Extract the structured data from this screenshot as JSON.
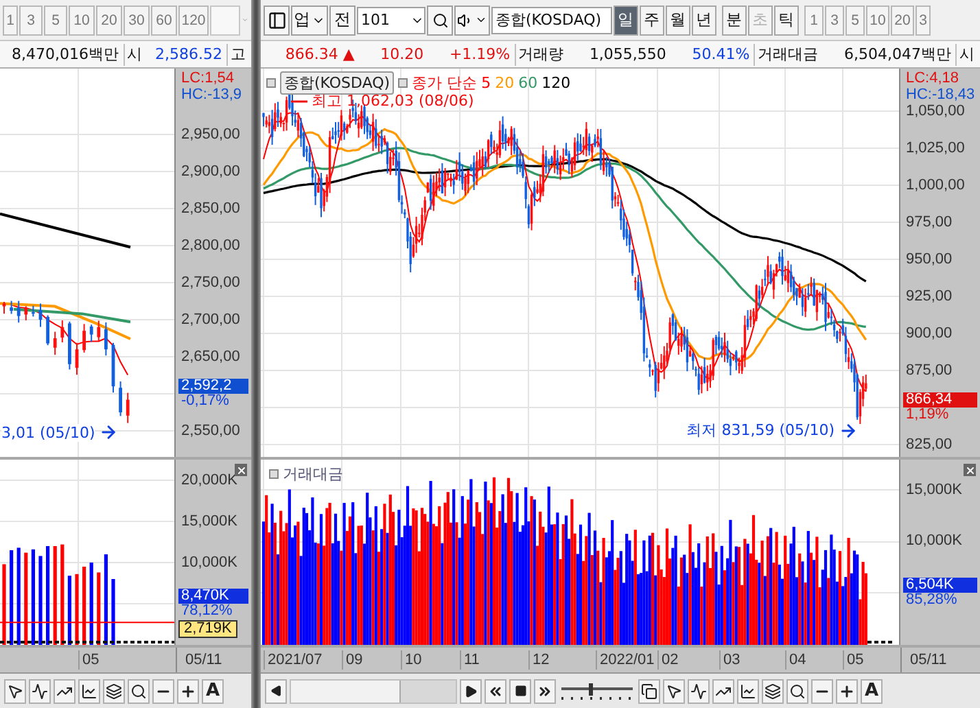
{
  "left_panel": {
    "period_buttons": [
      "1",
      "3",
      "5",
      "10",
      "20",
      "30",
      "60",
      "120"
    ],
    "quote": [
      {
        "kind": "value",
        "text": "8,470,016백만",
        "color": "#111111"
      },
      {
        "kind": "label",
        "text": "시",
        "color": "#111111"
      },
      {
        "kind": "value",
        "text": "2,586.52",
        "color": "#1040e0"
      },
      {
        "kind": "label",
        "text": "고",
        "color": "#111111"
      }
    ],
    "price_chart": {
      "low_note": "3,01 (05/10)",
      "axis": {
        "lc": "LC:1,54",
        "hc": "HC:-13,9",
        "upper_ticks": [
          "2,950,00",
          "2,900,00",
          "2,850,00",
          "2,800,00",
          "2,750,00",
          "2,700,00",
          "2,650,00"
        ],
        "lower_ticks": [
          "2,550,00"
        ],
        "current_tag": "2,592,2",
        "change": "-0,17%"
      }
    },
    "volume_chart": {
      "axis": {
        "upper_ticks": [
          "20,000K",
          "15,000K",
          "10,000K"
        ],
        "current_tag": "8,470K",
        "change": "78,12%",
        "marker_tag": "2,719K"
      }
    },
    "dates": [
      "05"
    ],
    "last_date": "05/11",
    "toolbar_text_button": "A"
  },
  "right_panel": {
    "toolbar": {
      "market_select": "업",
      "all_button": "전",
      "code_field": "101",
      "name_field": "종합(KOSDAQ)",
      "timeframe_tabs": [
        {
          "label": "일",
          "selected": true,
          "disabled": false
        },
        {
          "label": "주",
          "selected": false,
          "disabled": false
        },
        {
          "label": "월",
          "selected": false,
          "disabled": false
        },
        {
          "label": "년",
          "selected": false,
          "disabled": false
        }
      ],
      "intraday_tabs": [
        {
          "label": "분",
          "selected": false,
          "disabled": false
        },
        {
          "label": "초",
          "selected": false,
          "disabled": true
        },
        {
          "label": "틱",
          "selected": false,
          "disabled": false
        }
      ],
      "period_buttons": [
        "1",
        "3",
        "5",
        "10",
        "20",
        "3"
      ]
    },
    "quote": [
      {
        "kind": "value",
        "text": "866.34 ▲",
        "color": "#e01010"
      },
      {
        "kind": "value",
        "text": "10.20",
        "color": "#e01010"
      },
      {
        "kind": "value",
        "text": "+1.19%",
        "color": "#e01010"
      },
      {
        "kind": "label",
        "text": "거래량",
        "color": "#111111"
      },
      {
        "kind": "value",
        "text": "1,055,550",
        "color": "#111111"
      },
      {
        "kind": "value",
        "text": "50.41%",
        "color": "#1040e0"
      },
      {
        "kind": "label",
        "text": "거래대금",
        "color": "#111111"
      },
      {
        "kind": "value",
        "text": "6,504,047백만",
        "color": "#111111"
      },
      {
        "kind": "label",
        "text": "시",
        "color": "#111111"
      }
    ],
    "price_chart": {
      "legend": {
        "name": "종합(KOSDAQ)",
        "ma_label": "종가 단순",
        "ma_periods": [
          {
            "label": "5",
            "color": "#ff0000"
          },
          {
            "label": "20",
            "color": "#ff9900"
          },
          {
            "label": "60",
            "color": "#339966"
          },
          {
            "label": "120",
            "color": "#000000"
          }
        ]
      },
      "high_note": "최고 1,062,03 (08/06)",
      "low_note": "최저 831,59 (05/10)",
      "axis": {
        "lc": "LC:4,18",
        "hc": "HC:-18,43",
        "upper_ticks": [
          "1,050,00",
          "1,025,00",
          "1,000,00",
          "975,00",
          "950,00",
          "925,00",
          "900,00",
          "875,00"
        ],
        "lower_ticks": [
          "825,00"
        ],
        "current_tag": "866,34",
        "change": "1,19%"
      }
    },
    "volume_chart": {
      "legend": "거래대금",
      "axis": {
        "upper_ticks": [
          "15,000K",
          "10,000K"
        ],
        "current_tag": "6,504K",
        "change": "85,28%"
      }
    },
    "dates": [
      "2021/07",
      "09",
      "10",
      "11",
      "12",
      "2022/01",
      "02",
      "03",
      "04",
      "05"
    ],
    "last_date": "05/11",
    "toolbar_text_button": "A"
  }
}
